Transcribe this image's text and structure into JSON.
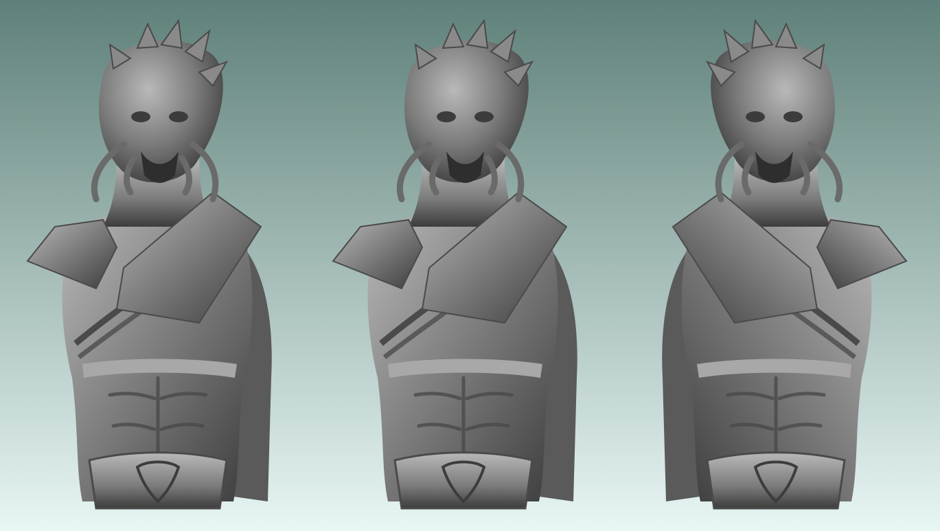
{
  "scene": {
    "background_top": "#5f807a",
    "background_bottom": "#e8f6f4",
    "material_base": "#7b7b7b",
    "material_light": "#b9b9b9",
    "material_dark": "#3c3c3c",
    "views": [
      {
        "name": "three-quarter-left",
        "mirrored": false
      },
      {
        "name": "front",
        "mirrored": false
      },
      {
        "name": "three-quarter-right",
        "mirrored": true
      }
    ]
  }
}
